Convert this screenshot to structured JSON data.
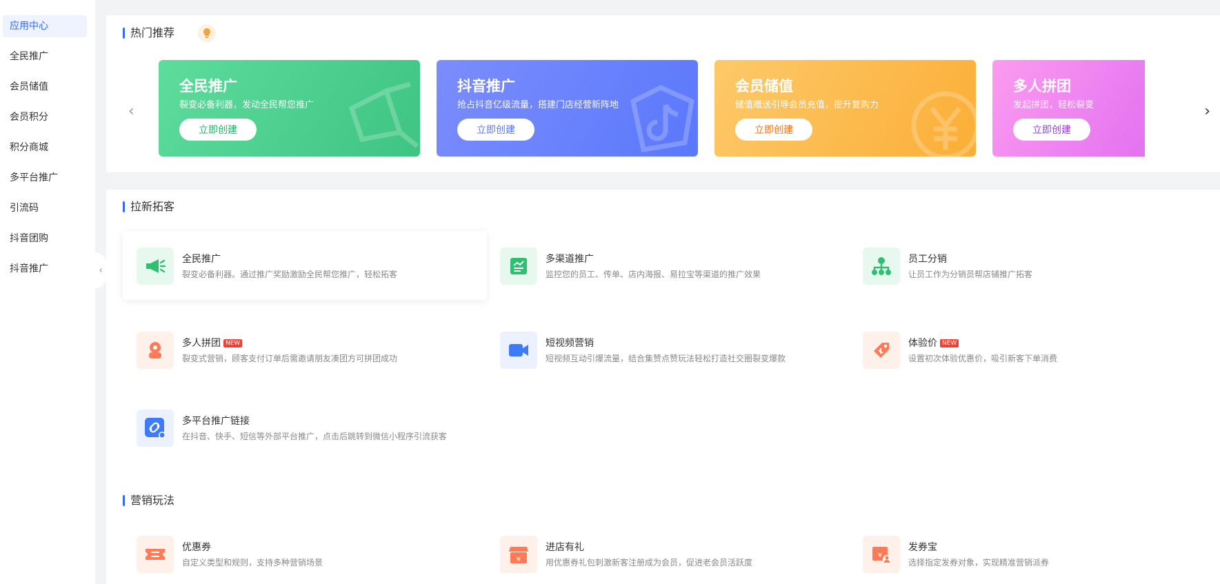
{
  "sidebar": {
    "items": [
      {
        "label": "应用中心"
      },
      {
        "label": "全民推广"
      },
      {
        "label": "会员储值"
      },
      {
        "label": "会员积分"
      },
      {
        "label": "积分商城"
      },
      {
        "label": "多平台推广"
      },
      {
        "label": "引流码"
      },
      {
        "label": "抖音团购"
      },
      {
        "label": "抖音推广"
      }
    ],
    "active_index": 0,
    "collapse_glyph": "‹"
  },
  "hot": {
    "title": "热门推荐",
    "prev_glyph": "‹",
    "next_glyph": "›",
    "banners": [
      {
        "title": "全民推广",
        "subtitle": "裂变必备利器，发动全民帮您推广",
        "button": "立即创建",
        "button_color": "#2fae6c",
        "icon": "megaphone-icon"
      },
      {
        "title": "抖音推广",
        "subtitle": "抢占抖音亿级流量，搭建门店经营新阵地",
        "button": "立即创建",
        "button_color": "#5a78fb",
        "icon": "douyin-icon"
      },
      {
        "title": "会员储值",
        "subtitle": "储值赠送引导会员充值，提升复购力",
        "button": "立即创建",
        "button_color": "#f2761e",
        "icon": "yuan-icon"
      },
      {
        "title": "多人拼团",
        "subtitle": "发起拼团，轻松裂变",
        "button": "立即创建",
        "button_color": "#9b3fe0",
        "icon": "group-icon"
      }
    ]
  },
  "lakeke": {
    "title": "拉新拓客",
    "items": [
      {
        "title": "全民推广",
        "desc": "裂变必备利器。通过推广奖励激励全民帮您推广，轻松拓客",
        "icon": "megaphone-icon",
        "new": false
      },
      {
        "title": "多渠道推广",
        "desc": "监控您的员工、传单、店内海报、易拉宝等渠道的推广效果",
        "icon": "chart-board-icon",
        "new": false
      },
      {
        "title": "员工分销",
        "desc": "让员工作为分销员帮店铺推广拓客",
        "icon": "org-tree-icon",
        "new": false
      },
      {
        "title": "多人拼团",
        "desc": "裂变式营销，顾客支付订单后需邀请朋友凑团方可拼团成功",
        "icon": "group-buy-icon",
        "new": true
      },
      {
        "title": "短视频营销",
        "desc": "短视频互动引爆流量，结合集赞点赞玩法轻松打造社交圈裂变爆款",
        "icon": "video-camera-icon",
        "new": false
      },
      {
        "title": "体验价",
        "desc": "设置初次体验优惠价，吸引新客下单消费",
        "icon": "price-tag-icon",
        "new": true
      },
      {
        "title": "多平台推广链接",
        "desc": "在抖音、快手、短信等外部平台推广，点击后跳转到微信小程序引流获客",
        "icon": "link-icon",
        "new": false
      }
    ],
    "new_label": "NEW"
  },
  "yingxiao": {
    "title": "营销玩法",
    "items": [
      {
        "title": "优惠券",
        "desc": "自定义类型和规则，支持多种营销场景",
        "icon": "coupon-icon"
      },
      {
        "title": "进店有礼",
        "desc": "用优惠券礼包刺激新客注册成为会员，促进老会员活跃度",
        "icon": "shop-gift-icon"
      },
      {
        "title": "发券宝",
        "desc": "选择指定发券对象，实现精准营销派券",
        "icon": "coupon-send-icon"
      }
    ]
  },
  "colors": {
    "accent": "#2f6bff",
    "green": "#32c27a",
    "orange": "#ff7a45",
    "blue": "#3d7bfa",
    "badge_red": "#f04134"
  }
}
